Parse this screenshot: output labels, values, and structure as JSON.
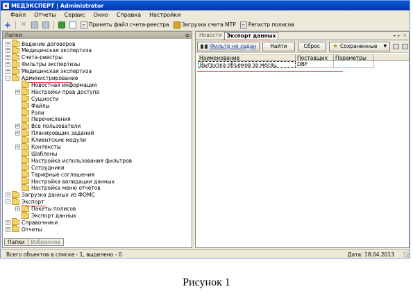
{
  "window": {
    "title": "МЕДЭКСПЕРТ | Administrator"
  },
  "menu": [
    "Файл",
    "Отчеты",
    "Сервис",
    "Окно",
    "Справка",
    "Настройки"
  ],
  "toolbar": {
    "accept_invoice": "Принять файл счета-реестра",
    "load_mtr_invoice": "Загрузка счета МТР",
    "policy_register": "Регистр полисов"
  },
  "left_panel": {
    "header": "Папки",
    "pin": "ф",
    "tree": [
      {
        "label": "Ведение договоров",
        "expander": "+"
      },
      {
        "label": "Медицинская экспертиза",
        "expander": "+"
      },
      {
        "label": "Счета-реестры",
        "expander": "+"
      },
      {
        "label": "Фильтры экспертизы",
        "expander": "+"
      },
      {
        "label": "Медицинская экспертиза",
        "expander": "+"
      },
      {
        "label": "Администрирование",
        "expander": "−"
      },
      {
        "label": "Новостная информация",
        "expander": ""
      },
      {
        "label": "Настройки прав доступа",
        "expander": "+"
      },
      {
        "label": "Сущности",
        "expander": ""
      },
      {
        "label": "Файлы",
        "expander": ""
      },
      {
        "label": "Роли",
        "expander": ""
      },
      {
        "label": "Перечисления",
        "expander": ""
      },
      {
        "label": "Все пользователи",
        "expander": "+"
      },
      {
        "label": "Планировщик заданий",
        "expander": "+"
      },
      {
        "label": "Клиентские модули",
        "expander": ""
      },
      {
        "label": "Контексты",
        "expander": "+"
      },
      {
        "label": "Шаблоны",
        "expander": ""
      },
      {
        "label": "Настройка использования фильтров",
        "expander": ""
      },
      {
        "label": "Сотрудники",
        "expander": ""
      },
      {
        "label": "Тарифные соглашения",
        "expander": ""
      },
      {
        "label": "Настройка валидации данных",
        "expander": ""
      },
      {
        "label": "Настройка меню отчетов",
        "expander": ""
      },
      {
        "label": "Загрузка данных из ФОМС",
        "expander": "+"
      },
      {
        "label": "Экспорт",
        "expander": "−"
      },
      {
        "label": "Пакеты полисов",
        "expander": "+"
      },
      {
        "label": "Экспорт данных",
        "expander": ""
      },
      {
        "label": "Справочники",
        "expander": "+"
      },
      {
        "label": "Отчеты",
        "expander": "+"
      }
    ],
    "bottom_tabs": [
      "Папки",
      "Избранное"
    ]
  },
  "right_panel": {
    "tabs": [
      "Новости",
      "Экспорт данных"
    ],
    "tab_nav": [
      "◂",
      "▸",
      "×"
    ],
    "buttons": {
      "filter": "Фильтр не задан",
      "find": "Найти",
      "reset": "Сброс",
      "saved": "Сохраненные"
    },
    "columns": [
      "Наименование",
      "Поставщик",
      "Параметры"
    ],
    "rows": [
      [
        "Выгрузка объемов за месяц",
        "DBF",
        ""
      ]
    ]
  },
  "status": {
    "count": "Всего объектов в списке - 1, выделено - 0",
    "date": "Дата: 18.04.2013"
  },
  "caption": "Рисунок 1"
}
